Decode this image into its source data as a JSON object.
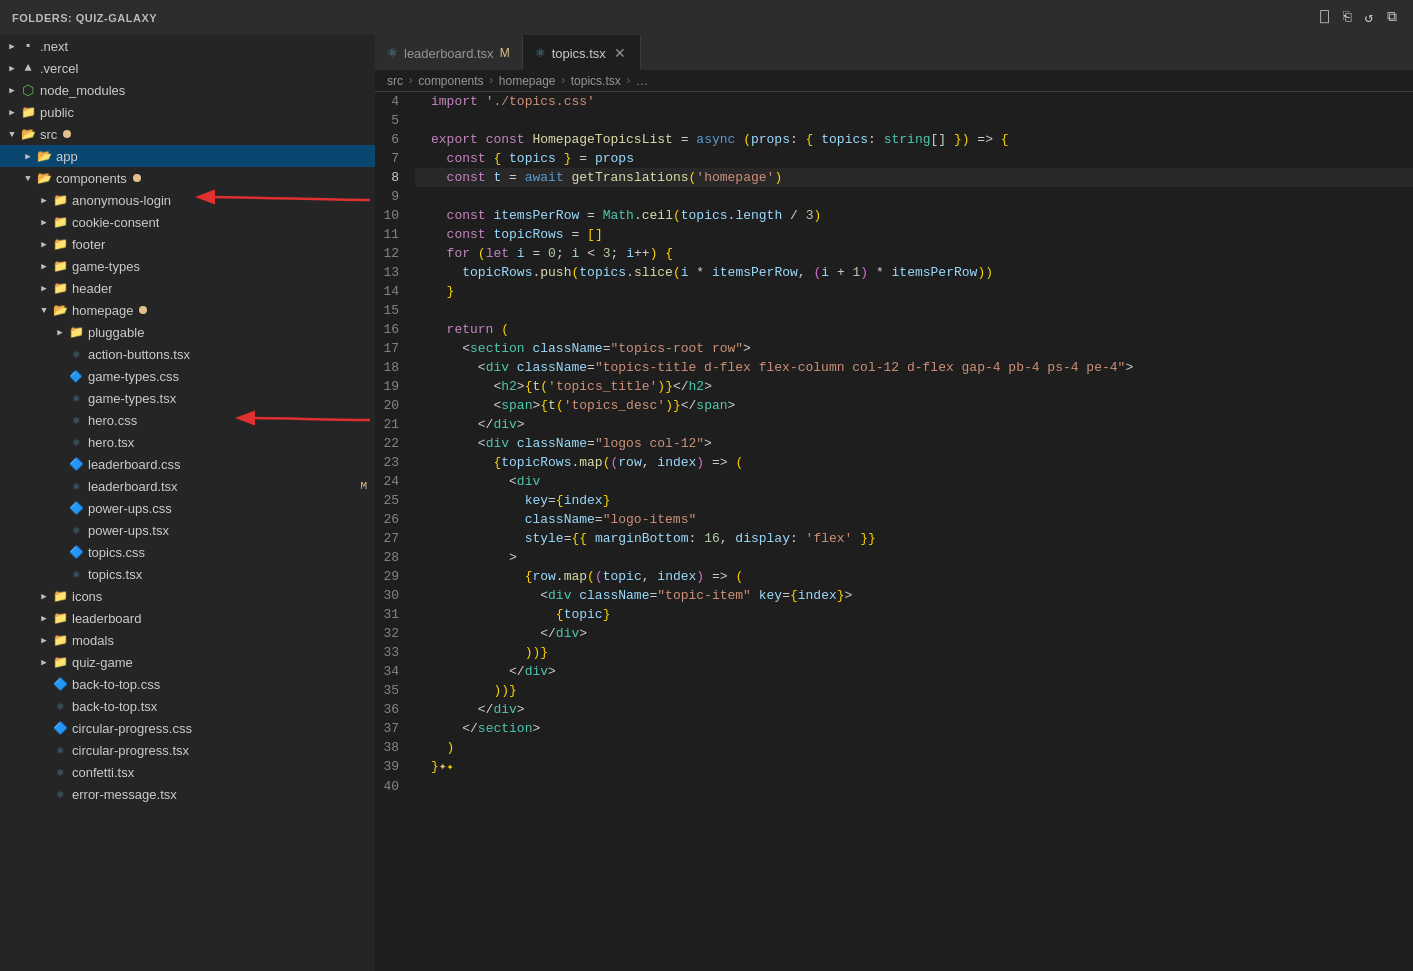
{
  "titleBar": {
    "folderLabel": "FOLDERS: QUIZ-GALAXY",
    "actions": [
      "new-file",
      "new-folder",
      "refresh",
      "collapse"
    ]
  },
  "sidebar": {
    "items": [
      {
        "id": "next",
        "label": ".next",
        "indent": 0,
        "type": "folder-collapsed",
        "icon": "folder"
      },
      {
        "id": "vercel",
        "label": ".vercel",
        "indent": 0,
        "type": "folder-collapsed",
        "icon": "folder"
      },
      {
        "id": "node_modules",
        "label": "node_modules",
        "indent": 0,
        "type": "folder-collapsed",
        "icon": "node"
      },
      {
        "id": "public",
        "label": "public",
        "indent": 0,
        "type": "folder-collapsed",
        "icon": "folder"
      },
      {
        "id": "src",
        "label": "src",
        "indent": 0,
        "type": "folder-expanded",
        "icon": "folder",
        "badge": true
      },
      {
        "id": "app",
        "label": "app",
        "indent": 1,
        "type": "folder-collapsed",
        "icon": "app",
        "selected": true
      },
      {
        "id": "components",
        "label": "components",
        "indent": 1,
        "type": "folder-expanded",
        "icon": "components",
        "badge": true
      },
      {
        "id": "anonymous-login",
        "label": "anonymous-login",
        "indent": 2,
        "type": "folder-collapsed",
        "icon": "folder"
      },
      {
        "id": "cookie-consent",
        "label": "cookie-consent",
        "indent": 2,
        "type": "folder-collapsed",
        "icon": "folder"
      },
      {
        "id": "footer",
        "label": "footer",
        "indent": 2,
        "type": "folder-collapsed",
        "icon": "folder"
      },
      {
        "id": "game-types",
        "label": "game-types",
        "indent": 2,
        "type": "folder-collapsed",
        "icon": "folder"
      },
      {
        "id": "header",
        "label": "header",
        "indent": 2,
        "type": "folder-collapsed",
        "icon": "folder"
      },
      {
        "id": "homepage",
        "label": "homepage",
        "indent": 2,
        "type": "folder-expanded",
        "icon": "folder",
        "badge": true
      },
      {
        "id": "pluggable",
        "label": "pluggable",
        "indent": 3,
        "type": "folder-collapsed",
        "icon": "folder"
      },
      {
        "id": "action-buttons-tsx",
        "label": "action-buttons.tsx",
        "indent": 3,
        "type": "file-tsx",
        "icon": "tsx"
      },
      {
        "id": "game-types-css",
        "label": "game-types.css",
        "indent": 3,
        "type": "file-css",
        "icon": "css"
      },
      {
        "id": "game-types-tsx",
        "label": "game-types.tsx",
        "indent": 3,
        "type": "file-tsx",
        "icon": "tsx"
      },
      {
        "id": "hero-css",
        "label": "hero.css",
        "indent": 3,
        "type": "file-css",
        "icon": "css"
      },
      {
        "id": "hero-tsx",
        "label": "hero.tsx",
        "indent": 3,
        "type": "file-tsx",
        "icon": "tsx"
      },
      {
        "id": "leaderboard-css",
        "label": "leaderboard.css",
        "indent": 3,
        "type": "file-css",
        "icon": "css"
      },
      {
        "id": "leaderboard-tsx",
        "label": "leaderboard.tsx",
        "indent": 3,
        "type": "file-tsx",
        "icon": "tsx",
        "modified": "M"
      },
      {
        "id": "power-ups-css",
        "label": "power-ups.css",
        "indent": 3,
        "type": "file-css",
        "icon": "css"
      },
      {
        "id": "power-ups-tsx",
        "label": "power-ups.tsx",
        "indent": 3,
        "type": "file-tsx",
        "icon": "tsx"
      },
      {
        "id": "topics-css",
        "label": "topics.css",
        "indent": 3,
        "type": "file-css",
        "icon": "css"
      },
      {
        "id": "topics-tsx",
        "label": "topics.tsx",
        "indent": 3,
        "type": "file-tsx",
        "icon": "tsx"
      },
      {
        "id": "icons",
        "label": "icons",
        "indent": 2,
        "type": "folder-collapsed",
        "icon": "folder"
      },
      {
        "id": "leaderboard",
        "label": "leaderboard",
        "indent": 2,
        "type": "folder-collapsed",
        "icon": "folder"
      },
      {
        "id": "modals",
        "label": "modals",
        "indent": 2,
        "type": "folder-collapsed",
        "icon": "folder"
      },
      {
        "id": "quiz-game",
        "label": "quiz-game",
        "indent": 2,
        "type": "folder-collapsed",
        "icon": "folder"
      },
      {
        "id": "back-to-top-css",
        "label": "back-to-top.css",
        "indent": 2,
        "type": "file-css",
        "icon": "css"
      },
      {
        "id": "back-to-top-tsx",
        "label": "back-to-top.tsx",
        "indent": 2,
        "type": "file-tsx",
        "icon": "tsx"
      },
      {
        "id": "circular-progress-css",
        "label": "circular-progress.css",
        "indent": 2,
        "type": "file-css",
        "icon": "css"
      },
      {
        "id": "circular-progress-tsx",
        "label": "circular-progress.tsx",
        "indent": 2,
        "type": "file-tsx",
        "icon": "tsx"
      },
      {
        "id": "confetti-tsx",
        "label": "confetti.tsx",
        "indent": 2,
        "type": "file-tsx",
        "icon": "tsx"
      },
      {
        "id": "error-message-tsx",
        "label": "error-message.tsx",
        "indent": 2,
        "type": "file-tsx",
        "icon": "tsx"
      }
    ]
  },
  "tabs": [
    {
      "id": "leaderboard-tsx",
      "label": "leaderboard.tsx",
      "icon": "tsx",
      "modified": true,
      "active": false,
      "closeable": false
    },
    {
      "id": "topics-tsx",
      "label": "topics.tsx",
      "icon": "tsx",
      "modified": false,
      "active": true,
      "closeable": true
    }
  ],
  "breadcrumb": {
    "items": [
      "src",
      "components",
      "homepage",
      "topics.tsx",
      "…"
    ]
  },
  "editor": {
    "filename": "topics.tsx",
    "lines": [
      {
        "num": 4,
        "content": "import './topics.css'"
      },
      {
        "num": 5,
        "content": ""
      },
      {
        "num": 6,
        "content": "export const HomepageTopicsList = async (props: { topics: string[] }) => {"
      },
      {
        "num": 7,
        "content": "  const { topics } = props"
      },
      {
        "num": 8,
        "content": "  const t = await getTranslations('homepage')",
        "active": true
      },
      {
        "num": 9,
        "content": ""
      },
      {
        "num": 10,
        "content": "  const itemsPerRow = Math.ceil(topics.length / 3)"
      },
      {
        "num": 11,
        "content": "  const topicRows = []"
      },
      {
        "num": 12,
        "content": "  for (let i = 0; i < 3; i++) {"
      },
      {
        "num": 13,
        "content": "    topicRows.push(topics.slice(i * itemsPerRow, (i + 1) * itemsPerRow))"
      },
      {
        "num": 14,
        "content": "  }"
      },
      {
        "num": 15,
        "content": ""
      },
      {
        "num": 16,
        "content": "  return ("
      },
      {
        "num": 17,
        "content": "    <section className=\"topics-root row\">"
      },
      {
        "num": 18,
        "content": "      <div className=\"topics-title d-flex flex-column col-12 d-flex gap-4 pb-4 ps-4 pe-4\">"
      },
      {
        "num": 19,
        "content": "        <h2>{t('topics_title')}</h2>"
      },
      {
        "num": 20,
        "content": "        <span>{t('topics_desc')}</span>"
      },
      {
        "num": 21,
        "content": "      </div>"
      },
      {
        "num": 22,
        "content": "      <div className=\"logos col-12\">"
      },
      {
        "num": 23,
        "content": "        {topicRows.map((row, index) => ("
      },
      {
        "num": 24,
        "content": "          <div"
      },
      {
        "num": 25,
        "content": "            key={index}"
      },
      {
        "num": 26,
        "content": "            className=\"logo-items\""
      },
      {
        "num": 27,
        "content": "            style={{ marginBottom: 16, display: 'flex' }}"
      },
      {
        "num": 28,
        "content": "          >"
      },
      {
        "num": 29,
        "content": "            {row.map((topic, index) => ("
      },
      {
        "num": 30,
        "content": "              <div className=\"topic-item\" key={index}>"
      },
      {
        "num": 31,
        "content": "                {topic}"
      },
      {
        "num": 32,
        "content": "              </div>"
      },
      {
        "num": 33,
        "content": "            ))}"
      },
      {
        "num": 34,
        "content": "          </div>"
      },
      {
        "num": 35,
        "content": "        ))}"
      },
      {
        "num": 36,
        "content": "      </div>"
      },
      {
        "num": 37,
        "content": "    </section>"
      },
      {
        "num": 38,
        "content": "  )"
      },
      {
        "num": 39,
        "content": "}"
      },
      {
        "num": 40,
        "content": ""
      }
    ]
  }
}
